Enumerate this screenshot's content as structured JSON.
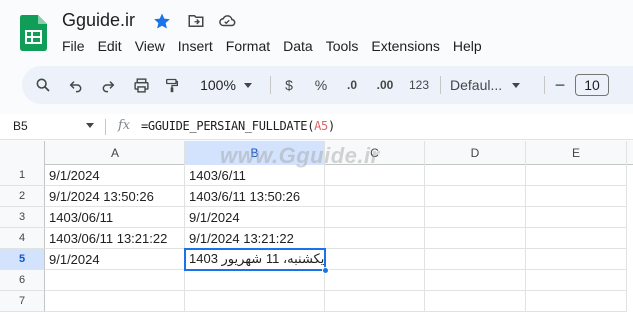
{
  "app": {
    "doc_title": "Gguide.ir",
    "menu": [
      "File",
      "Edit",
      "View",
      "Insert",
      "Format",
      "Data",
      "Tools",
      "Extensions",
      "Help"
    ]
  },
  "toolbar": {
    "zoom": "100%",
    "currency": "$",
    "percent": "%",
    "dec_decrease": ".0",
    "dec_increase": ".00",
    "number_format": "123",
    "font_name": "Defaul...",
    "font_size": "10",
    "minus": "−"
  },
  "formula_bar": {
    "name_box": "B5",
    "fx": "fx",
    "formula_prefix": "=GGUIDE_PERSIAN_FULLDATE(",
    "formula_ref": "A5",
    "formula_suffix": ")"
  },
  "watermark": "www.Gguide.ir",
  "grid": {
    "columns": [
      "A",
      "B",
      "C",
      "D",
      "E"
    ],
    "rows": [
      "1",
      "2",
      "3",
      "4",
      "5",
      "6",
      "7"
    ],
    "cells": {
      "A1": "9/1/2024",
      "B1": "1403/6/11",
      "A2": "9/1/2024 13:50:26",
      "B2": "1403/6/11 13:50:26",
      "A3": "1403/06/11",
      "B3": "9/1/2024",
      "A4": "1403/06/11 13:21:22",
      "B4": "9/1/2024 13:21:22",
      "A5": "9/1/2024",
      "B5": "یکشنبه، 11 شهریور 1403"
    },
    "selected_cell": "B5"
  },
  "colors": {
    "accent": "#1a73e8",
    "selected_header": "#d3e3fd",
    "toolbar_bg": "#edf2fa",
    "sheets_green": "#0f9d58",
    "star_blue": "#1a73e8",
    "ref_red": "#e06666"
  }
}
